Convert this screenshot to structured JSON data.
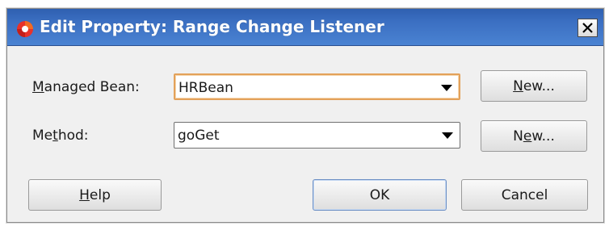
{
  "dialog": {
    "title": "Edit Property: Range Change Listener",
    "close_glyph": "✕",
    "icon": "app-icon"
  },
  "fields": {
    "bean": {
      "label_mn": "M",
      "label_rest": "anaged Bean:",
      "value": "HRBean",
      "new_pre": "",
      "new_mn": "N",
      "new_post": "ew..."
    },
    "method": {
      "label_pre": "Me",
      "label_mn": "t",
      "label_rest": "hod:",
      "value": "goGet",
      "new_pre": "N",
      "new_mn": "e",
      "new_post": "w..."
    }
  },
  "footer": {
    "help_mn": "H",
    "help_rest": "elp",
    "ok": "OK",
    "cancel": "Cancel"
  },
  "colors": {
    "title_bar": "#3b6fc2",
    "focus_ring": "#e3a15a",
    "default_button_border": "#6c8fc4"
  }
}
